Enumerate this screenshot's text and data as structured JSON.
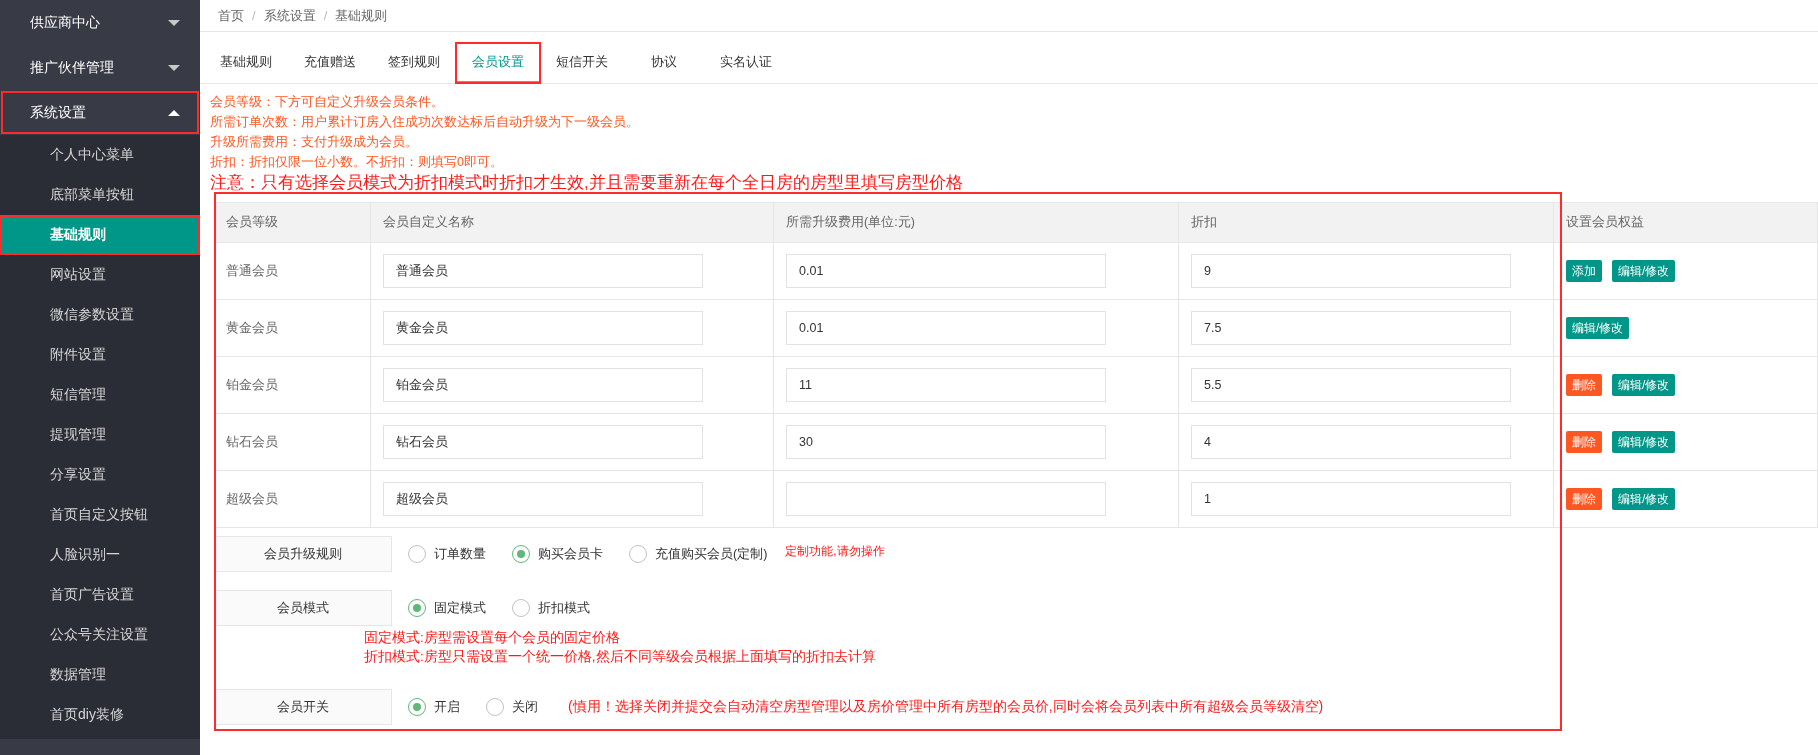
{
  "sidebar": {
    "groups": [
      {
        "label": "供应商中心",
        "expanded": false,
        "annotated": false
      },
      {
        "label": "推广伙伴管理",
        "expanded": false,
        "annotated": false
      },
      {
        "label": "系统设置",
        "expanded": true,
        "annotated": true,
        "children": [
          {
            "label": "个人中心菜单",
            "selected": false,
            "annotated": false
          },
          {
            "label": "底部菜单按钮",
            "selected": false,
            "annotated": false
          },
          {
            "label": "基础规则",
            "selected": true,
            "annotated": true
          },
          {
            "label": "网站设置",
            "selected": false,
            "annotated": false
          },
          {
            "label": "微信参数设置",
            "selected": false,
            "annotated": false
          },
          {
            "label": "附件设置",
            "selected": false,
            "annotated": false
          },
          {
            "label": "短信管理",
            "selected": false,
            "annotated": false
          },
          {
            "label": "提现管理",
            "selected": false,
            "annotated": false
          },
          {
            "label": "分享设置",
            "selected": false,
            "annotated": false
          },
          {
            "label": "首页自定义按钮",
            "selected": false,
            "annotated": false
          },
          {
            "label": "人脸识别一",
            "selected": false,
            "annotated": false
          },
          {
            "label": "首页广告设置",
            "selected": false,
            "annotated": false
          },
          {
            "label": "公众号关注设置",
            "selected": false,
            "annotated": false
          },
          {
            "label": "数据管理",
            "selected": false,
            "annotated": false
          },
          {
            "label": "首页diy装修",
            "selected": false,
            "annotated": false
          }
        ]
      }
    ]
  },
  "breadcrumb": [
    "首页",
    "系统设置",
    "基础规则"
  ],
  "breadcrumb_separator": "/",
  "tabs": [
    {
      "label": "基础规则",
      "selected": false,
      "annotated": false
    },
    {
      "label": "充值赠送",
      "selected": false,
      "annotated": false
    },
    {
      "label": "签到规则",
      "selected": false,
      "annotated": false
    },
    {
      "label": "会员设置",
      "selected": true,
      "annotated": true
    },
    {
      "label": "短信开关",
      "selected": false,
      "annotated": false
    },
    {
      "label": "协议",
      "selected": false,
      "annotated": false
    },
    {
      "label": "实名认证",
      "selected": false,
      "annotated": false
    }
  ],
  "notes": [
    "会员等级：下方可自定义升级会员条件。",
    "所需订单次数：用户累计订房入住成功次数达标后自动升级为下一级会员。",
    "升级所需费用：支付升级成为会员。",
    "折扣：折扣仅限一位小数。不折扣：则填写0即可。"
  ],
  "notice": "注意：只有选择会员模式为折扣模式时折扣才生效,并且需要重新在每个全日房的房型里填写房型价格",
  "form": {
    "annotated": true,
    "table": {
      "columns": [
        "会员等级",
        "会员自定义名称",
        "所需升级费用(单位:元)",
        "折扣",
        "设置会员权益"
      ],
      "rows": [
        {
          "level": "普通会员",
          "name": "普通会员",
          "fee": "0.01",
          "discount": "9",
          "actions": [
            {
              "label": "添加",
              "kind": "add"
            },
            {
              "label": "编辑/修改",
              "kind": "edit"
            }
          ]
        },
        {
          "level": "黄金会员",
          "name": "黄金会员",
          "fee": "0.01",
          "discount": "7.5",
          "actions": [
            {
              "label": "编辑/修改",
              "kind": "edit"
            }
          ]
        },
        {
          "level": "铂金会员",
          "name": "铂金会员",
          "fee": "11",
          "discount": "5.5",
          "actions": [
            {
              "label": "删除",
              "kind": "delete"
            },
            {
              "label": "编辑/修改",
              "kind": "edit"
            }
          ]
        },
        {
          "level": "钻石会员",
          "name": "钻石会员",
          "fee": "30",
          "discount": "4",
          "actions": [
            {
              "label": "删除",
              "kind": "delete"
            },
            {
              "label": "编辑/修改",
              "kind": "edit"
            }
          ]
        },
        {
          "level": "超级会员",
          "name": "超级会员",
          "discount": "1",
          "actions": [
            {
              "label": "删除",
              "kind": "delete"
            },
            {
              "label": "编辑/修改",
              "kind": "edit"
            }
          ]
        }
      ]
    },
    "settings": [
      {
        "label": "会员升级规则",
        "options": [
          {
            "label": "订单数量",
            "selected": false
          },
          {
            "label": "购买会员卡",
            "selected": true
          },
          {
            "label": "充值购买会员(定制)",
            "selected": false
          }
        ],
        "note": "定制功能,请勿操作",
        "kind": "small"
      },
      {
        "label": "会员模式",
        "options": [
          {
            "label": "固定模式",
            "selected": true
          },
          {
            "label": "折扣模式",
            "selected": false
          }
        ],
        "notes_below": [
          "固定模式:房型需设置每个会员的固定价格",
          "折扣模式:房型只需设置一个统一价格,然后不同等级会员根据上面填写的折扣去计算"
        ]
      },
      {
        "label": "会员开关",
        "options": [
          {
            "label": "开启",
            "selected": true
          },
          {
            "label": "关闭",
            "selected": false
          }
        ],
        "note": "(慎用！选择关闭并提交会自动清空房型管理以及房价管理中所有房型的会员价,同时会将会员列表中所有超级会员等级清空)",
        "kind": "large"
      }
    ]
  }
}
